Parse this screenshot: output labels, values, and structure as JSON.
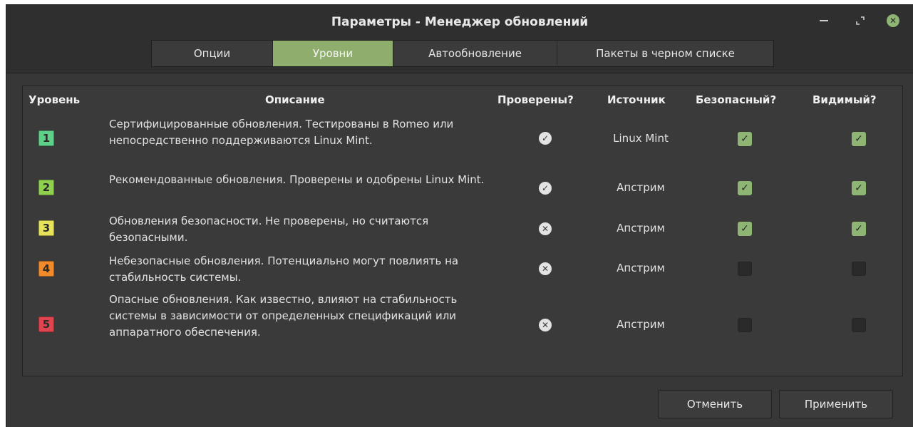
{
  "window": {
    "title": "Параметры - Менеджер обновлений"
  },
  "tabs": [
    {
      "label": "Опции",
      "active": false
    },
    {
      "label": "Уровни",
      "active": true
    },
    {
      "label": "Автообновление",
      "active": false
    },
    {
      "label": "Пакеты в черном списке",
      "active": false
    }
  ],
  "table": {
    "headers": {
      "level": "Уровень",
      "description": "Описание",
      "checked": "Проверены?",
      "source": "Источник",
      "safe": "Безопасный?",
      "visible": "Видимый?"
    },
    "rows": [
      {
        "level": "1",
        "badge_color": "#5fd08a",
        "description": "Сертифицированные обновления. Тестированы в Romeo или непосредственно поддерживаются Linux Mint.",
        "checked": "check",
        "source": "Linux Mint",
        "safe": true,
        "visible": true
      },
      {
        "level": "2",
        "badge_color": "#8fd04f",
        "description": "Рекомендованные обновления. Проверены и одобрены Linux Mint.",
        "checked": "check",
        "source": "Апстрим",
        "safe": true,
        "visible": true
      },
      {
        "level": "3",
        "badge_color": "#e6e35a",
        "description": "Обновления безопасности. Не проверены, но считаются безопасными.",
        "checked": "cross",
        "source": "Апстрим",
        "safe": true,
        "visible": true
      },
      {
        "level": "4",
        "badge_color": "#f08a2a",
        "description": "Небезопасные обновления. Потенциально могут повлиять на стабильность системы.",
        "checked": "cross",
        "source": "Апстрим",
        "safe": false,
        "visible": false
      },
      {
        "level": "5",
        "badge_color": "#e0444e",
        "description": "Опасные обновления. Как известно, влияют на стабильность системы в зависимости от определенных спецификаций или аппаратного обеспечения.",
        "checked": "cross",
        "source": "Апстрим",
        "safe": false,
        "visible": false
      }
    ]
  },
  "buttons": {
    "cancel": "Отменить",
    "apply": "Применить"
  },
  "icons": {
    "check": "check-circle-icon",
    "cross": "cross-circle-icon",
    "close": "close-icon",
    "minimize": "minimize-icon",
    "maximize": "maximize-icon"
  }
}
